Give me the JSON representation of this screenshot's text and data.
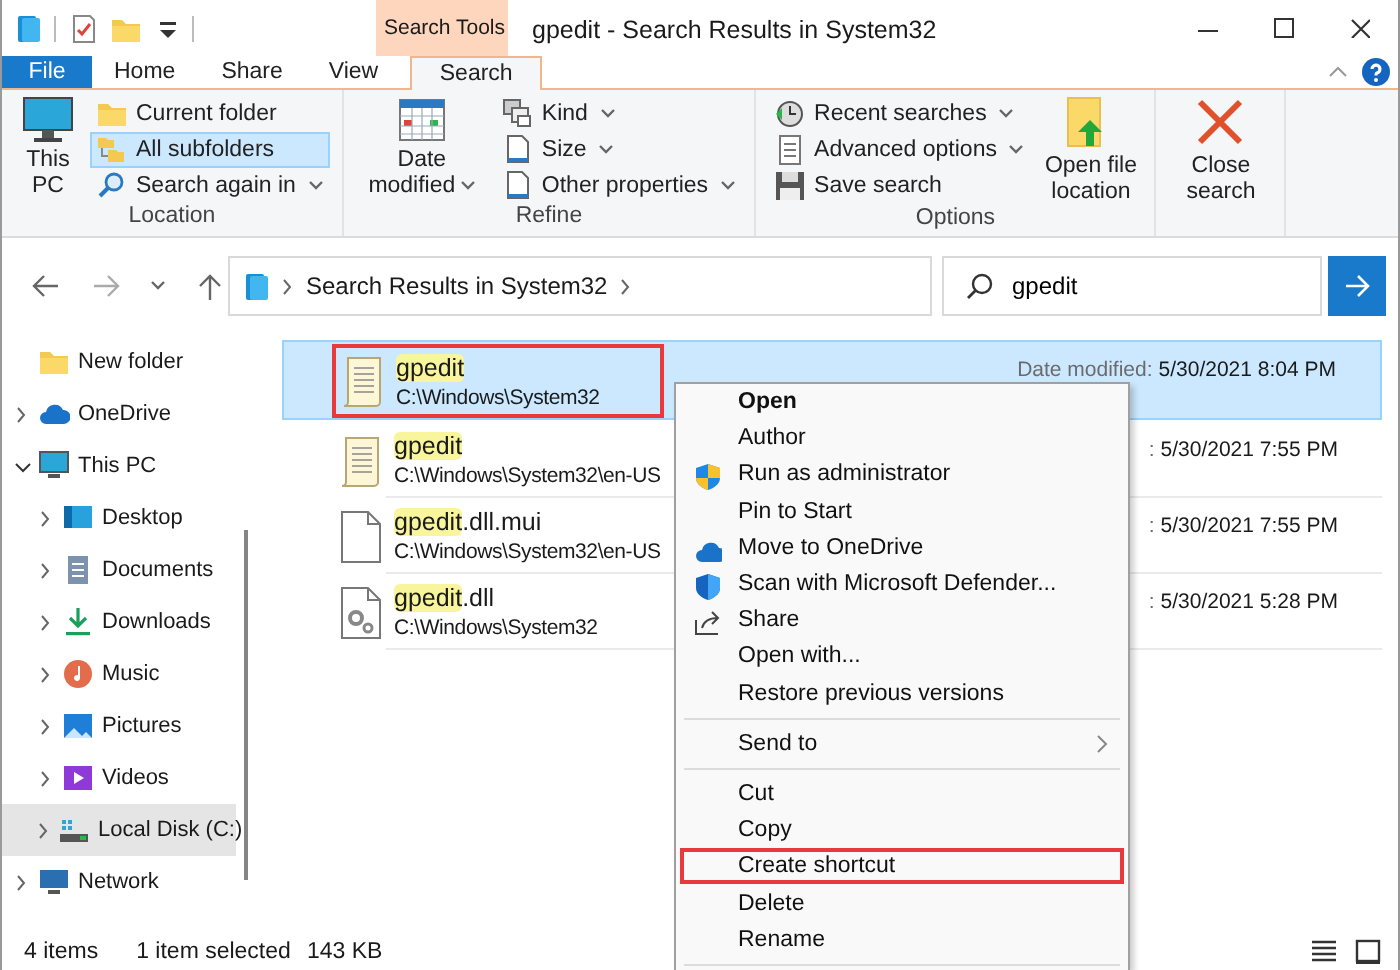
{
  "window": {
    "title": "gpedit - Search Results in System32",
    "context_tab": "Search Tools"
  },
  "tabs": [
    {
      "label": "File",
      "kind": "file",
      "selected": false
    },
    {
      "label": "Home",
      "kind": "tab",
      "selected": false
    },
    {
      "label": "Share",
      "kind": "tab",
      "selected": false
    },
    {
      "label": "View",
      "kind": "tab",
      "selected": false
    },
    {
      "label": "Search",
      "kind": "tab",
      "selected": true
    }
  ],
  "ribbon": {
    "groups": [
      {
        "label": "Location",
        "items": [
          {
            "kind": "large",
            "label": "This PC",
            "dropdown": false
          },
          {
            "kind": "stack",
            "items": [
              {
                "label": "Current folder",
                "dropdown": false,
                "selected": false
              },
              {
                "label": "All subfolders",
                "dropdown": false,
                "selected": true
              },
              {
                "label": "Search again in",
                "dropdown": true,
                "selected": false
              }
            ]
          }
        ]
      },
      {
        "label": "Refine",
        "items": [
          {
            "kind": "large",
            "label": "Date modified",
            "dropdown": true
          },
          {
            "kind": "stack",
            "items": [
              {
                "label": "Kind",
                "dropdown": true,
                "selected": false
              },
              {
                "label": "Size",
                "dropdown": true,
                "selected": false
              },
              {
                "label": "Other properties",
                "dropdown": true,
                "selected": false
              }
            ]
          }
        ]
      },
      {
        "label": "Options",
        "items": [
          {
            "kind": "stack",
            "items": [
              {
                "label": "Recent searches",
                "dropdown": true,
                "selected": false
              },
              {
                "label": "Advanced options",
                "dropdown": true,
                "selected": false
              },
              {
                "label": "Save search",
                "dropdown": false,
                "selected": false
              }
            ]
          },
          {
            "kind": "large",
            "label": "Open file location",
            "dropdown": false
          }
        ]
      },
      {
        "items": [
          {
            "kind": "large",
            "label": "Close search",
            "dropdown": false
          }
        ]
      }
    ]
  },
  "address": {
    "path": "Search Results in System32"
  },
  "search": {
    "value": "gpedit"
  },
  "sidebar": {
    "items": [
      {
        "label": "New folder",
        "selected": false
      },
      {
        "label": "OneDrive",
        "expanded": false,
        "selected": false
      },
      {
        "label": "This PC",
        "expanded": true,
        "selected": false,
        "children": [
          {
            "label": "Desktop",
            "expanded": false,
            "selected": false
          },
          {
            "label": "Documents",
            "expanded": false,
            "selected": false
          },
          {
            "label": "Downloads",
            "expanded": false,
            "selected": false
          },
          {
            "label": "Music",
            "expanded": false,
            "selected": false
          },
          {
            "label": "Pictures",
            "expanded": false,
            "selected": false
          },
          {
            "label": "Videos",
            "expanded": false,
            "selected": false
          },
          {
            "label": "Local Disk (C:)",
            "expanded": false,
            "selected": true
          }
        ]
      },
      {
        "label": "Network",
        "expanded": false,
        "selected": false
      }
    ]
  },
  "files": [
    {
      "match": "gpedit",
      "path": "C:\\Windows\\System32",
      "date_label": "Date modified:",
      "date": "5/30/2021 8:04 PM",
      "selected": true,
      "highlighted": true
    },
    {
      "match": "gpedit",
      "path": "C:\\Windows\\System32\\en-US",
      "date_label": ":",
      "date": "5/30/2021 7:55 PM",
      "selected": false,
      "highlighted": false
    },
    {
      "match": "gpedit",
      "rest": ".dll.mui",
      "path": "C:\\Windows\\System32\\en-US",
      "date_label": ":",
      "date": "5/30/2021 7:55 PM",
      "selected": false,
      "highlighted": false
    },
    {
      "match": "gpedit",
      "rest": ".dll",
      "path": "C:\\Windows\\System32",
      "date_label": ":",
      "date": "5/30/2021 5:28 PM",
      "selected": false,
      "highlighted": false
    }
  ],
  "context_menu": [
    {
      "kind": "item",
      "label": "Open",
      "default": true,
      "submenu": false,
      "highlighted": false
    },
    {
      "kind": "item",
      "label": "Author",
      "default": false,
      "submenu": false,
      "highlighted": false
    },
    {
      "kind": "item",
      "label": "Run as administrator",
      "default": false,
      "submenu": false,
      "highlighted": false
    },
    {
      "kind": "item",
      "label": "Pin to Start",
      "default": false,
      "submenu": false,
      "highlighted": false
    },
    {
      "kind": "item",
      "label": "Move to OneDrive",
      "default": false,
      "submenu": false,
      "highlighted": false
    },
    {
      "kind": "item",
      "label": "Scan with Microsoft Defender...",
      "default": false,
      "submenu": false,
      "highlighted": false
    },
    {
      "kind": "item",
      "label": "Share",
      "default": false,
      "submenu": false,
      "highlighted": false
    },
    {
      "kind": "item",
      "label": "Open with...",
      "default": false,
      "submenu": false,
      "highlighted": false
    },
    {
      "kind": "item",
      "label": "Restore previous versions",
      "default": false,
      "submenu": false,
      "highlighted": false
    },
    {
      "kind": "separator"
    },
    {
      "kind": "item",
      "label": "Send to",
      "default": false,
      "submenu": true,
      "highlighted": false
    },
    {
      "kind": "separator"
    },
    {
      "kind": "item",
      "label": "Cut",
      "default": false,
      "submenu": false,
      "highlighted": false
    },
    {
      "kind": "item",
      "label": "Copy",
      "default": false,
      "submenu": false,
      "highlighted": false
    },
    {
      "kind": "item",
      "label": "Create shortcut",
      "default": false,
      "submenu": false,
      "highlighted": true
    },
    {
      "kind": "item",
      "label": "Delete",
      "default": false,
      "submenu": false,
      "highlighted": false
    },
    {
      "kind": "item",
      "label": "Rename",
      "default": false,
      "submenu": false,
      "highlighted": false
    },
    {
      "kind": "separator"
    }
  ],
  "status_bar": {
    "count": "4 items",
    "selection": "1 item selected",
    "size": "143 KB"
  }
}
